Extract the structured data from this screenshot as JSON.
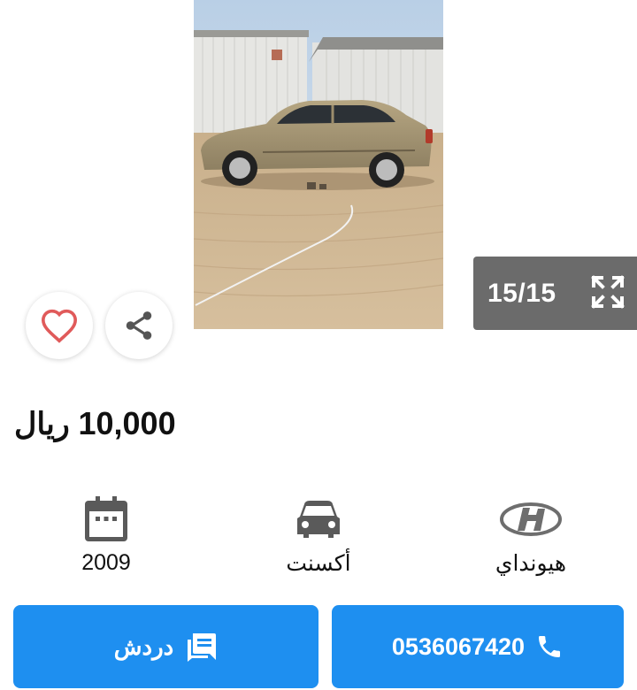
{
  "gallery": {
    "counter": "15/15",
    "icons": {
      "prev": "chevron-left-icon",
      "next": "chevron-right-icon",
      "expand": "expand-icon"
    }
  },
  "actions_top": {
    "favorite_icon": "heart-icon",
    "share_icon": "share-icon"
  },
  "listing": {
    "price": "10,000",
    "currency": "ريال"
  },
  "specs": {
    "year": "2009",
    "model": "أكسنت",
    "brand": "هيونداي"
  },
  "buttons": {
    "chat_label": "دردش",
    "phone": "0536067420"
  },
  "colors": {
    "primary": "#1e8ff0",
    "counter_bg": "#6b6b6b",
    "heart": "#e05a5a"
  }
}
